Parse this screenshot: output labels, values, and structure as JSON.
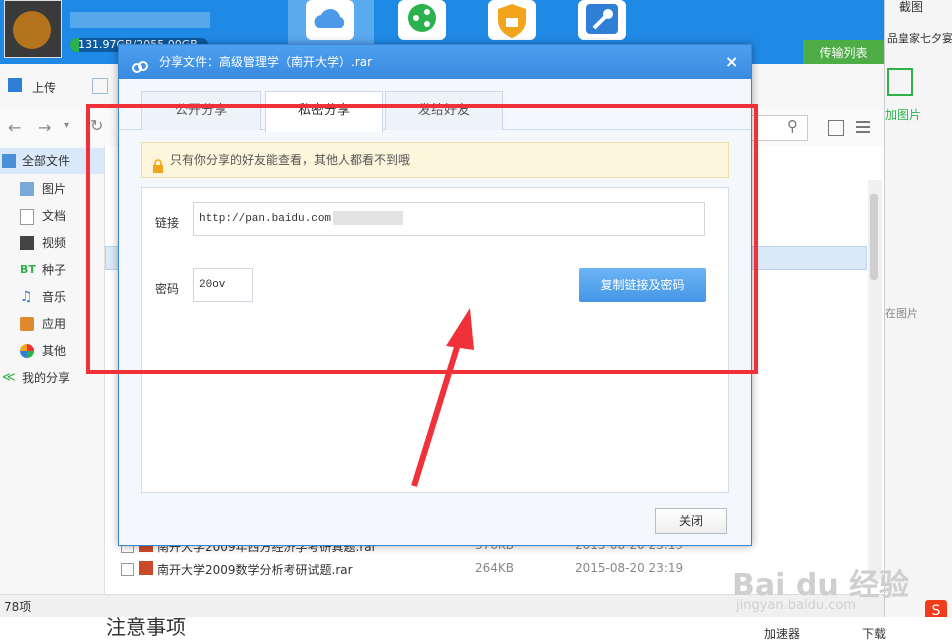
{
  "header": {
    "quota_text": "131.97GB/2055.00GB",
    "quota_fraction": 0.064,
    "colors": {
      "bar": "#1f8ae6",
      "quota_fill": "#2bb24c"
    }
  },
  "right_panel": {
    "top_label": "截图",
    "ad_text": "品皇家七夕宴",
    "add_image_label": "加图片",
    "image_label": "在图片"
  },
  "transfer_button": "传输列表",
  "toolbar": {
    "upload_label": "上传"
  },
  "sidebar": {
    "items": [
      {
        "label": "全部文件",
        "icon": "folder-icon"
      },
      {
        "label": "图片",
        "icon": "image-icon"
      },
      {
        "label": "文档",
        "icon": "document-icon"
      },
      {
        "label": "视频",
        "icon": "video-icon"
      },
      {
        "label": "种子",
        "icon": "bt-icon"
      },
      {
        "label": "音乐",
        "icon": "music-icon"
      },
      {
        "label": "应用",
        "icon": "app-icon"
      },
      {
        "label": "其他",
        "icon": "other-icon"
      },
      {
        "label": "我的分享",
        "icon": "share-icon"
      }
    ]
  },
  "files": [
    {
      "name": "南开大学2009年西方经济学考研真题.rar",
      "size": "376KB",
      "date": "2015-08-20 23:19"
    },
    {
      "name": "南开大学2009数学分析考研试题.rar",
      "size": "264KB",
      "date": "2015-08-20 23:19"
    }
  ],
  "status": {
    "count": "78项"
  },
  "bottom": {
    "note_heading": "注意事项",
    "accelerator": "加速器",
    "download": "下载"
  },
  "dialog": {
    "title": "分享文件：高级管理学（南开大学）.rar",
    "close_symbol": "×",
    "tabs": [
      "公开分享",
      "私密分享",
      "发给好友"
    ],
    "active_tab": 1,
    "notice": "只有你分享的好友能查看，其他人都看不到哦",
    "link_label": "链接",
    "link_value": "http://pan.baidu.com",
    "password_label": "密码",
    "password_value": "20ov",
    "copy_button": "复制链接及密码",
    "close_button": "关闭"
  },
  "watermark": {
    "brand": "Bai du 经验",
    "url": "jingyan.baidu.com"
  },
  "annotation_colors": {
    "highlight": "#f0313a"
  }
}
